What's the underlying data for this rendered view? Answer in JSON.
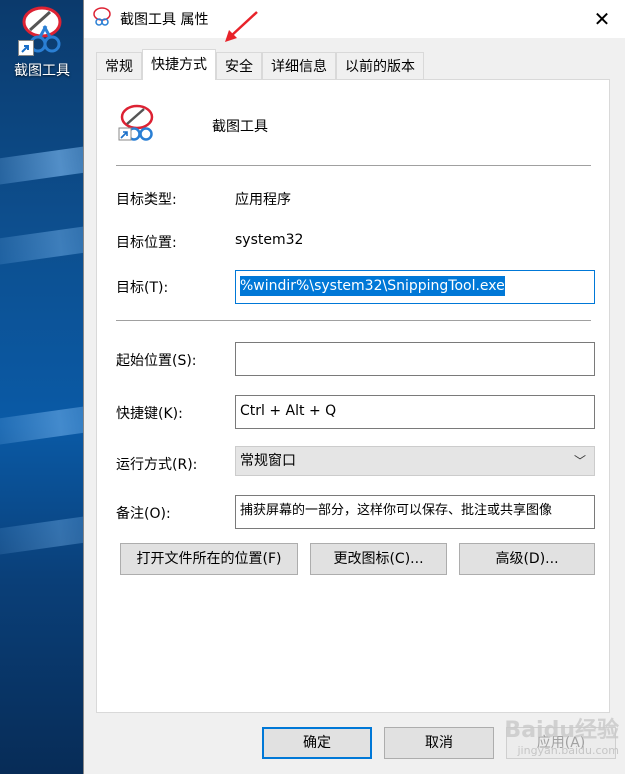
{
  "desktop": {
    "icon_label": "截图工具"
  },
  "window": {
    "title": "截图工具 属性",
    "tabs": [
      "常规",
      "快捷方式",
      "安全",
      "详细信息",
      "以前的版本"
    ],
    "active_tab": "快捷方式"
  },
  "shortcut": {
    "name": "截图工具",
    "target_type_label": "目标类型:",
    "target_type_value": "应用程序",
    "target_location_label": "目标位置:",
    "target_location_value": "system32",
    "target_label": "目标(T):",
    "target_value": "%windir%\\system32\\SnippingTool.exe",
    "start_in_label": "起始位置(S):",
    "start_in_value": "",
    "hotkey_label": "快捷键(K):",
    "hotkey_value": "Ctrl + Alt + Q",
    "run_label": "运行方式(R):",
    "run_value": "常规窗口",
    "comment_label": "备注(O):",
    "comment_value": "捕获屏幕的一部分，这样你可以保存、批注或共享图像"
  },
  "actions": {
    "open_location": "打开文件所在的位置(F)",
    "change_icon": "更改图标(C)...",
    "advanced": "高级(D)..."
  },
  "footer": {
    "ok": "确定",
    "cancel": "取消",
    "apply": "应用(A)"
  },
  "watermark": {
    "brand": "Baidu经验",
    "url": "jingyan.baidu.com"
  },
  "colors": {
    "accent": "#0078d7",
    "annotation_arrow": "#e8232a"
  }
}
